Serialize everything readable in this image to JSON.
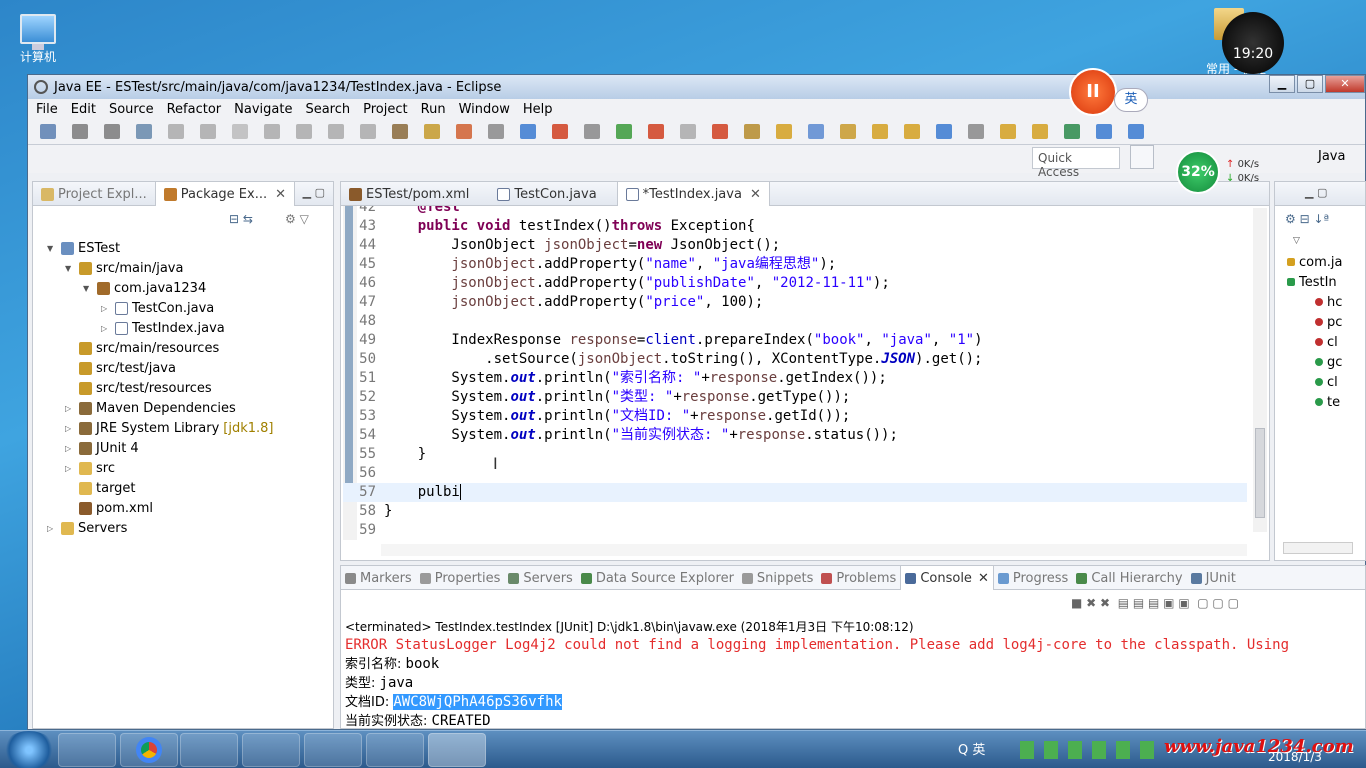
{
  "desktop": {
    "computer_label": "计算机",
    "clock_time": "19:20",
    "folder_label": "常用 - 快捷"
  },
  "window": {
    "title": "Java EE - ESTest/src/main/java/com/java1234/TestIndex.java - Eclipse"
  },
  "menu": [
    "File",
    "Edit",
    "Source",
    "Refactor",
    "Navigate",
    "Search",
    "Project",
    "Run",
    "Window",
    "Help"
  ],
  "quick_access": "Quick Access",
  "perspective": "Java",
  "left_panel": {
    "tabs": [
      "Project Expl...",
      "Package Ex..."
    ],
    "tree": [
      {
        "label": "ESTest",
        "indent": 0,
        "twisty": "▼",
        "icon": "project"
      },
      {
        "label": "src/main/java",
        "indent": 1,
        "twisty": "▼",
        "icon": "srcfolder"
      },
      {
        "label": "com.java1234",
        "indent": 2,
        "twisty": "▼",
        "icon": "package"
      },
      {
        "label": "TestCon.java",
        "indent": 3,
        "twisty": "▷",
        "icon": "javafile"
      },
      {
        "label": "TestIndex.java",
        "indent": 3,
        "twisty": "▷",
        "icon": "javafile"
      },
      {
        "label": "src/main/resources",
        "indent": 1,
        "twisty": "",
        "icon": "srcfolder"
      },
      {
        "label": "src/test/java",
        "indent": 1,
        "twisty": "",
        "icon": "srcfolder"
      },
      {
        "label": "src/test/resources",
        "indent": 1,
        "twisty": "",
        "icon": "srcfolder"
      },
      {
        "label": "Maven Dependencies",
        "indent": 1,
        "twisty": "▷",
        "icon": "library"
      },
      {
        "label": "JRE System Library",
        "decoration": "[jdk1.8]",
        "indent": 1,
        "twisty": "▷",
        "icon": "library"
      },
      {
        "label": "JUnit 4",
        "indent": 1,
        "twisty": "▷",
        "icon": "library"
      },
      {
        "label": "src",
        "indent": 1,
        "twisty": "▷",
        "icon": "folder"
      },
      {
        "label": "target",
        "indent": 1,
        "twisty": "",
        "icon": "folder"
      },
      {
        "label": "pom.xml",
        "indent": 1,
        "twisty": "",
        "icon": "xmlfile"
      },
      {
        "label": "Servers",
        "indent": 0,
        "twisty": "▷",
        "icon": "folder"
      }
    ]
  },
  "editor": {
    "tabs": [
      "ESTest/pom.xml",
      "TestCon.java",
      "*TestIndex.java"
    ],
    "lines": [
      {
        "n": "42",
        "html": "    <span class=\"kw\">@Test</span>"
      },
      {
        "n": "43",
        "html": "    <span class=\"kw\">public</span> <span class=\"kw\">void</span> testIndex()<span class=\"kw\">throws</span> Exception{"
      },
      {
        "n": "44",
        "html": "        JsonObject <span class=\"var\">jsonObject</span>=<span class=\"kw\">new</span> JsonObject();"
      },
      {
        "n": "45",
        "html": "        <span class=\"var\">jsonObject</span>.addProperty(<span class=\"str\">\"name\"</span>, <span class=\"str\">\"java编程思想\"</span>);"
      },
      {
        "n": "46",
        "html": "        <span class=\"var\">jsonObject</span>.addProperty(<span class=\"str\">\"publishDate\"</span>, <span class=\"str\">\"2012-11-11\"</span>);"
      },
      {
        "n": "47",
        "html": "        <span class=\"var\">jsonObject</span>.addProperty(<span class=\"str\">\"price\"</span>, 100);"
      },
      {
        "n": "48",
        "html": ""
      },
      {
        "n": "49",
        "html": "        IndexResponse <span class=\"var\">response</span>=<span style=\"color:#0000c0\">client</span>.prepareIndex(<span class=\"str\">\"book\"</span>, <span class=\"str\">\"java\"</span>, <span class=\"str\">\"1\"</span>)"
      },
      {
        "n": "50",
        "html": "            .setSource(<span class=\"var\">jsonObject</span>.toString(), XContentType.<span class=\"fld\">JSON</span>).get();"
      },
      {
        "n": "51",
        "html": "        System.<span class=\"fld\">out</span>.println(<span class=\"str\">\"索引名称: \"</span>+<span class=\"var\">response</span>.getIndex());"
      },
      {
        "n": "52",
        "html": "        System.<span class=\"fld\">out</span>.println(<span class=\"str\">\"类型: \"</span>+<span class=\"var\">response</span>.getType());"
      },
      {
        "n": "53",
        "html": "        System.<span class=\"fld\">out</span>.println(<span class=\"str\">\"文档ID: \"</span>+<span class=\"var\">response</span>.getId());"
      },
      {
        "n": "54",
        "html": "        System.<span class=\"fld\">out</span>.println(<span class=\"str\">\"当前实例状态: \"</span>+<span class=\"var\">response</span>.status());"
      },
      {
        "n": "55",
        "html": "    }"
      },
      {
        "n": "56",
        "html": ""
      },
      {
        "n": "57",
        "html": "    pulbi"
      },
      {
        "n": "58",
        "html": "}"
      },
      {
        "n": "59",
        "html": ""
      }
    ]
  },
  "outline": {
    "items": [
      "com.ja",
      "TestIn",
      "hc",
      "pc",
      "cl",
      "gc",
      "cl",
      "te"
    ]
  },
  "bottom_panel": {
    "tabs": [
      "Markers",
      "Properties",
      "Servers",
      "Data Source Explorer",
      "Snippets",
      "Problems",
      "Console",
      "Progress",
      "Call Hierarchy",
      "JUnit"
    ],
    "terminated": "<terminated> TestIndex.testIndex [JUnit] D:\\jdk1.8\\bin\\javaw.exe (2018年1月3日 下午10:08:12)",
    "error_line": "ERROR StatusLogger Log4j2 could not find a logging implementation. Please add log4j-core to the classpath. Using",
    "out_index_label": "索引名称: ",
    "out_index_value": "book",
    "out_type_label": "类型: ",
    "out_type_value": "java",
    "out_id_label": "文档ID: ",
    "out_id_value": "AWC8WjQPhA46pS36vfhk",
    "out_status_label": "当前实例状态: ",
    "out_status_value": "CREATED"
  },
  "overlays": {
    "record_btn": "II",
    "ime": "英",
    "speed_pct": "32%",
    "up_speed": "0K/s",
    "down_speed": "0K/s"
  },
  "taskbar": {
    "tray_ime": "英",
    "watermark": "www.java1234.com",
    "date": "2018/1/3"
  }
}
